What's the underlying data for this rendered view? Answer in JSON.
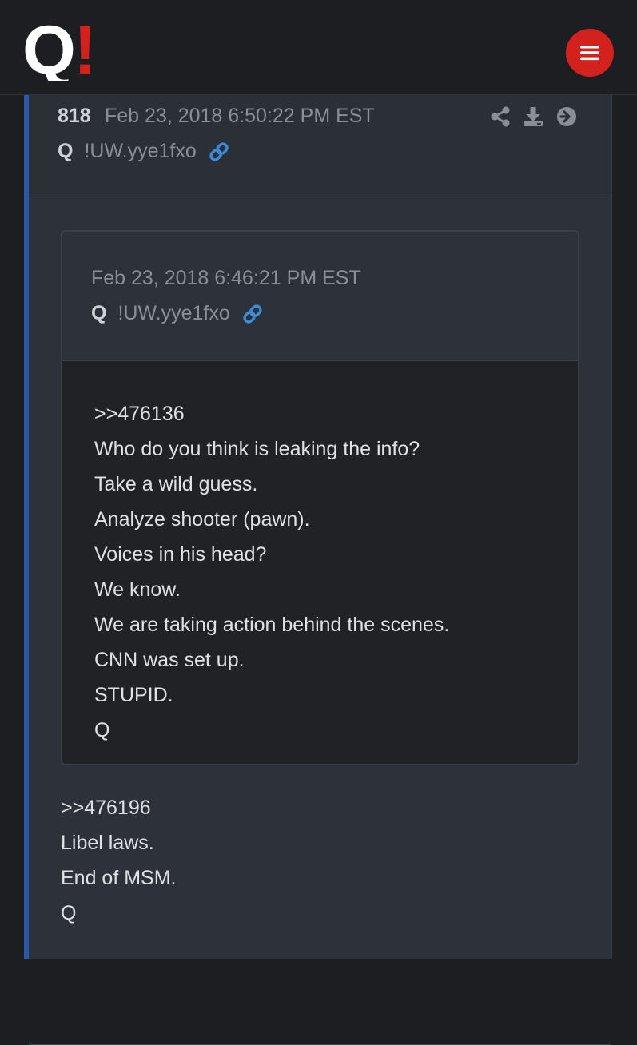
{
  "header": {
    "logo_letter": "Q",
    "logo_mark": "!",
    "menu_icon": "hamburger-menu-icon",
    "brand_red": "#d3221d"
  },
  "post": {
    "number": "818",
    "date": "Feb 23, 2018 6:50:22 PM EST",
    "author": "Q",
    "tripcode": "!UW.yye1fxo",
    "actions": [
      "share-icon",
      "download-icon",
      "arrow-right-circle-icon"
    ],
    "accent_color": "#2b58a8",
    "quote": {
      "date": "Feb 23, 2018 6:46:21 PM EST",
      "author": "Q",
      "tripcode": "!UW.yye1fxo",
      "lines": [
        ">>476136",
        "Who do you think is leaking the info?",
        "Take a wild guess.",
        "Analyze shooter (pawn).",
        "Voices in his head?",
        "We know.",
        "We are taking action behind the scenes.",
        "CNN was set up.",
        "STUPID.",
        "Q"
      ]
    },
    "reply_lines": [
      ">>476196",
      "Libel laws.",
      "End of MSM.",
      "Q"
    ]
  }
}
